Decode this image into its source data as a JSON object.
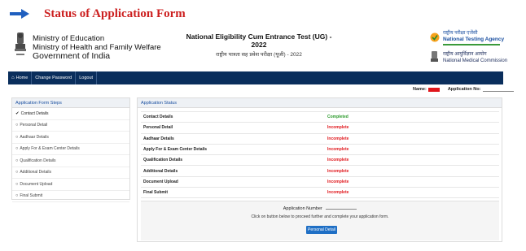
{
  "page_heading": "Status of Application Form",
  "header": {
    "ministry_line1": "Ministry of Education",
    "ministry_line2": "Ministry of Health and Family Welfare",
    "ministry_line3": "Government of India",
    "title_en": "National Eligibility Cum Entrance Test (UG) - 2022",
    "title_hi": "राष्ट्रीय पात्रता सह प्रवेश परीक्षा (यूजी) - 2022",
    "nta_hi": "राष्ट्रीय परीक्षा एजेंसी",
    "nta_en": "National Testing Agency",
    "nmc_hi": "राष्ट्रीय आयुर्विज्ञान आयोग",
    "nmc_en": "National Medical Commission"
  },
  "nav": {
    "home": "Home",
    "change_password": "Change Password",
    "logout": "Logout"
  },
  "user": {
    "name_label": "Name:",
    "app_no_label": "Application No:"
  },
  "steps": {
    "title": "Application Form Steps",
    "items": [
      {
        "label": "Contact Details",
        "icon": "check-circle-icon"
      },
      {
        "label": "Personal Detail",
        "icon": "circle-icon"
      },
      {
        "label": "Aadhaar Details",
        "icon": "circle-icon"
      },
      {
        "label": "Apply For & Exam Center Details",
        "icon": "circle-icon"
      },
      {
        "label": "Qualification Details",
        "icon": "circle-icon"
      },
      {
        "label": "Additional Details",
        "icon": "circle-icon"
      },
      {
        "label": "Document Upload",
        "icon": "circle-icon"
      },
      {
        "label": "Final Submit",
        "icon": "circle-icon"
      }
    ]
  },
  "status": {
    "title": "Application Status",
    "rows": [
      {
        "label": "Contact Details",
        "value": "Completed",
        "color": "#2a9a2a"
      },
      {
        "label": "Personal Detail",
        "value": "Incomplete",
        "color": "#e0161b"
      },
      {
        "label": "Aadhaar Details",
        "value": "Incomplete",
        "color": "#e0161b"
      },
      {
        "label": "Apply For & Exam Center Details",
        "value": "Incomplete",
        "color": "#e0161b"
      },
      {
        "label": "Qualification Details",
        "value": "Incomplete",
        "color": "#e0161b"
      },
      {
        "label": "Additional Details",
        "value": "Incomplete",
        "color": "#e0161b"
      },
      {
        "label": "Document Upload",
        "value": "Incomplete",
        "color": "#e0161b"
      },
      {
        "label": "Final Submit",
        "value": "Incomplete",
        "color": "#e0161b"
      }
    ]
  },
  "footer_box": {
    "app_number_label": "Application Number",
    "proceed_text": "Click on button below to proceed further and complete your application form.",
    "button_label": "Personal Detail"
  },
  "colors": {
    "navbar": "#0a2e5c",
    "heading_red": "#cc1f1f",
    "accent_blue": "#1f6fc5"
  }
}
